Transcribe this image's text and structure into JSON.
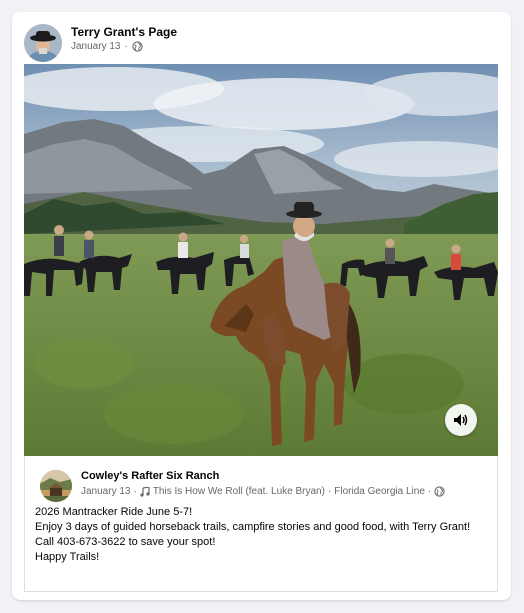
{
  "post": {
    "page_name": "Terry Grant's Page",
    "date": "January 13",
    "separator": "·",
    "privacy_icon": "globe-icon"
  },
  "media": {
    "sound_icon": "speaker-icon"
  },
  "shared_post": {
    "page_name": "Cowley's Rafter Six Ranch",
    "date": "January 13",
    "separator": "·",
    "music_icon": "music-note-icon",
    "song": "This Is How We Roll (feat. Luke Bryan)",
    "separator2": "·",
    "artist": "Florida Georgia Line",
    "separator3": "·",
    "privacy_icon": "globe-icon",
    "lines": [
      "2026 Mantracker Ride June 5-7!",
      "Enjoy 3 days of guided horseback trails, campfire stories and good food, with Terry Grant!",
      "Call 403-673-3622 to save your spot!",
      "Happy Trails!"
    ]
  },
  "colors": {
    "background": "#f0f2f5",
    "card": "#ffffff",
    "text_primary": "#050505",
    "text_secondary": "#65676b",
    "border": "#dadde1"
  }
}
